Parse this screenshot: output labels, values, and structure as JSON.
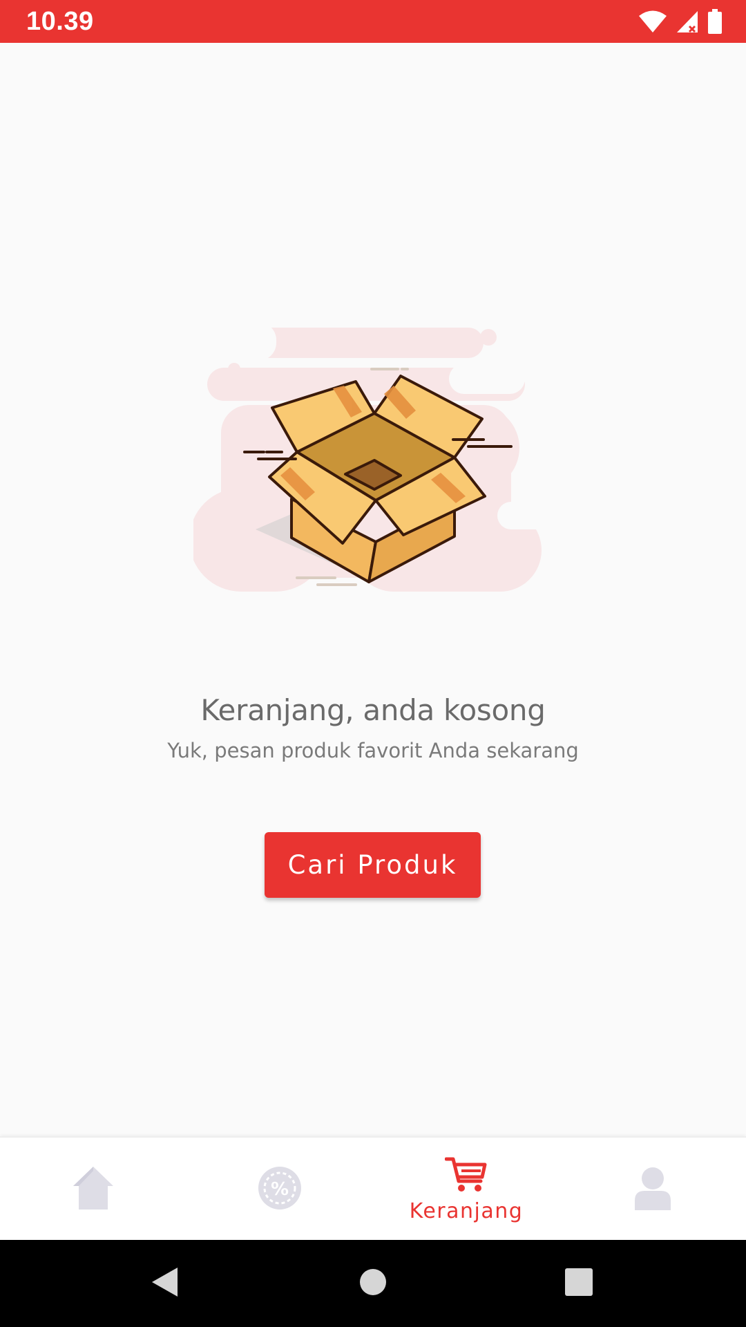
{
  "status_bar": {
    "time": "10.39",
    "icons": [
      "wifi-icon",
      "cellular-signal-icon",
      "battery-icon"
    ]
  },
  "empty_state": {
    "illustration": "open-box-illustration",
    "title": "Keranjang, anda kosong",
    "subtitle": "Yuk, pesan produk favorit Anda sekarang",
    "button_label": "Cari Produk"
  },
  "bottom_nav": {
    "items": [
      {
        "icon": "home-icon",
        "label": "",
        "active": false
      },
      {
        "icon": "promo-percent-icon",
        "label": "",
        "active": false
      },
      {
        "icon": "cart-icon",
        "label": "Keranjang",
        "active": true
      },
      {
        "icon": "profile-icon",
        "label": "",
        "active": false
      }
    ]
  },
  "system_nav": {
    "buttons": [
      "back-icon",
      "home-circle-icon",
      "recents-icon"
    ]
  },
  "colors": {
    "brand": "#e93431",
    "inactive_icon": "#dedde6",
    "background": "#fafafa",
    "text_title": "#6a6a6a",
    "text_subtitle": "#7a7a7a"
  }
}
